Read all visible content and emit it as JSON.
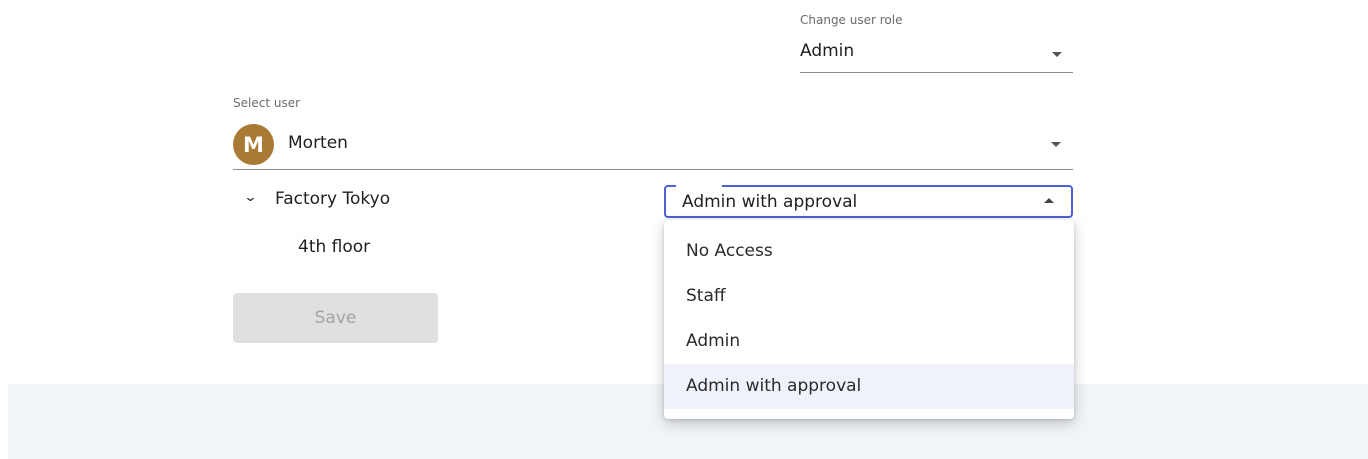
{
  "role_select": {
    "label": "Change user role",
    "value": "Admin",
    "caret_icon": "caret-down-icon"
  },
  "user_select": {
    "label": "Select user",
    "avatar_initial": "M",
    "avatar_color": "#a97a35",
    "value": "Morten",
    "caret_icon": "caret-down-icon"
  },
  "tree": {
    "expand_icon": "chevron-down-icon",
    "site": "Factory Tokyo",
    "child": "4th floor"
  },
  "access_select": {
    "value": "Admin with approval",
    "caret_icon": "caret-up-icon",
    "accent_color": "#4f5fd6",
    "options": [
      "No Access",
      "Staff",
      "Admin",
      "Admin with approval"
    ],
    "selected": "Admin with approval"
  },
  "actions": {
    "save_label": "Save",
    "save_disabled": true
  }
}
